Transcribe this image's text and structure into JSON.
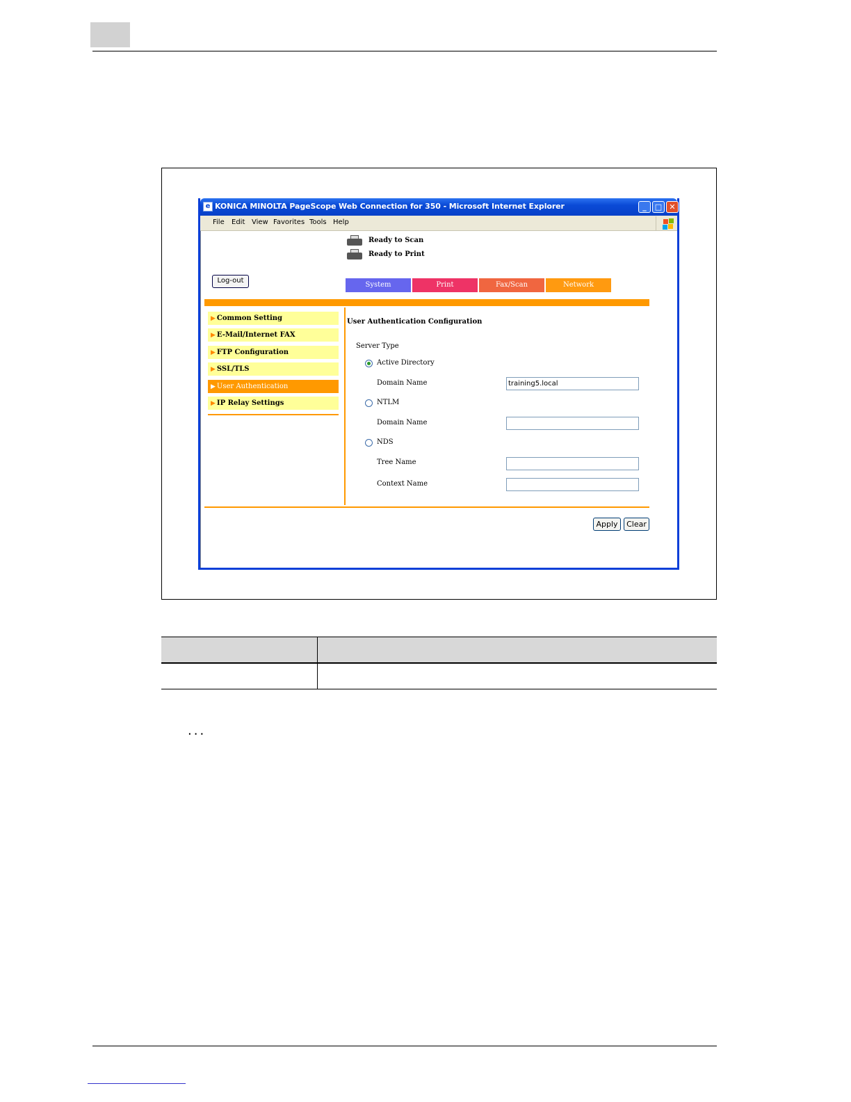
{
  "browser": {
    "title": "KONICA MINOLTA PageScope Web Connection for 350 - Microsoft Internet Explorer",
    "menu": [
      "File",
      "Edit",
      "View",
      "Favorites",
      "Tools",
      "Help"
    ],
    "window_buttons": {
      "minimize": "_",
      "maximize": "□",
      "close": "✕"
    }
  },
  "status": {
    "scan": "Ready to Scan",
    "print": "Ready to Print"
  },
  "logout_label": "Log-out",
  "tabs": [
    "System",
    "Print",
    "Fax/Scan",
    "Network"
  ],
  "tab_colors": {
    "system": "#6666ee",
    "print": "#ee3366",
    "fax": "#f06640",
    "network": "#ff9a10"
  },
  "accent_color": "#ff9900",
  "sidebar": {
    "items": [
      {
        "label": "Common Setting",
        "active": false
      },
      {
        "label": "E-Mail/Internet FAX",
        "active": false
      },
      {
        "label": "FTP Configuration",
        "active": false
      },
      {
        "label": "SSL/TLS",
        "active": false
      },
      {
        "label": "User Authentication",
        "active": true
      },
      {
        "label": "IP Relay Settings",
        "active": false
      }
    ]
  },
  "form": {
    "title": "User Authentication Configuration",
    "server_type_label": "Server Type",
    "options": {
      "active_directory": {
        "label": "Active Directory",
        "selected": true,
        "domain_label": "Domain Name",
        "domain_value": "training5.local"
      },
      "ntlm": {
        "label": "NTLM",
        "selected": false,
        "domain_label": "Domain Name",
        "domain_value": ""
      },
      "nds": {
        "label": "NDS",
        "selected": false,
        "tree_label": "Tree Name",
        "tree_value": "",
        "context_label": "Context Name",
        "context_value": ""
      }
    }
  },
  "buttons": {
    "apply": "Apply",
    "clear": "Clear"
  },
  "ellipsis": "..."
}
